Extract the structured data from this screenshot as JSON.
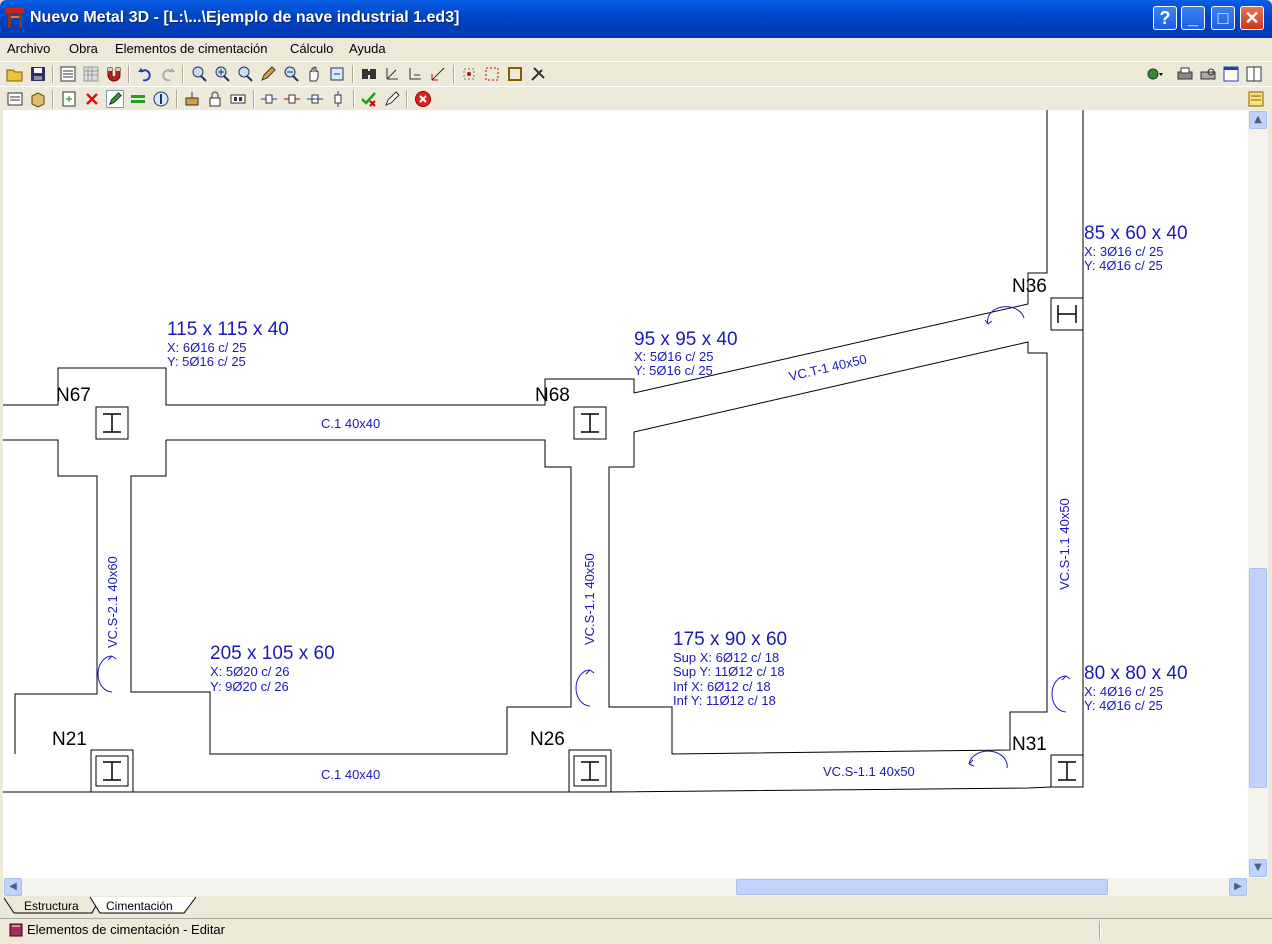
{
  "window": {
    "title": "Nuevo Metal 3D - [L:\\...\\Ejemplo de nave industrial 1.ed3]"
  },
  "window_buttons": {
    "help": "?",
    "minimize": "_",
    "maximize": "□",
    "close": "✕"
  },
  "menu": [
    "Archivo",
    "Obra",
    "Elementos de cimentación",
    "Cálculo",
    "Ayuda"
  ],
  "tabs": [
    "Estructura",
    "Cimentación"
  ],
  "status": {
    "text": "Elementos de cimentación - Editar"
  },
  "drawing": {
    "nodes": [
      "N67",
      "N68",
      "N36",
      "N21",
      "N26",
      "N31"
    ],
    "footings": [
      {
        "size": "115 x 115 x 40",
        "lines": [
          "X: 6Ø16 c/ 25",
          "Y: 5Ø16 c/ 25"
        ]
      },
      {
        "size": "95 x 95 x 40",
        "lines": [
          "X: 5Ø16 c/ 25",
          "Y: 5Ø16 c/ 25"
        ]
      },
      {
        "size": "85 x 60 x 40",
        "lines": [
          "X: 3Ø16 c/ 25",
          "Y: 4Ø16 c/ 25"
        ]
      },
      {
        "size": "205 x 105 x 60",
        "lines": [
          "X: 5Ø20 c/ 26",
          "Y: 9Ø20 c/ 26"
        ]
      },
      {
        "size": "175 x 90 x 60",
        "lines": [
          "Sup X: 6Ø12 c/ 18",
          "Sup Y: 11Ø12 c/ 18",
          "Inf X: 6Ø12 c/ 18",
          "Inf Y: 11Ø12 c/ 18"
        ]
      },
      {
        "size": "80 x 80 x 40",
        "lines": [
          "X: 4Ø16 c/ 25",
          "Y: 4Ø16 c/ 25"
        ]
      }
    ],
    "beams": [
      "C.1 40x40",
      "VC.T-1 40x50",
      "VC.S-1.1 40x50",
      "VC.S-2.1 40x60",
      "VC.S-1.1 40x50",
      "C.1 40x40",
      "VC.S-1.1 40x50"
    ]
  },
  "colors": {
    "label_blue": "#1a1ab8",
    "outline": "#000000",
    "title_bar": "#0054e3"
  }
}
